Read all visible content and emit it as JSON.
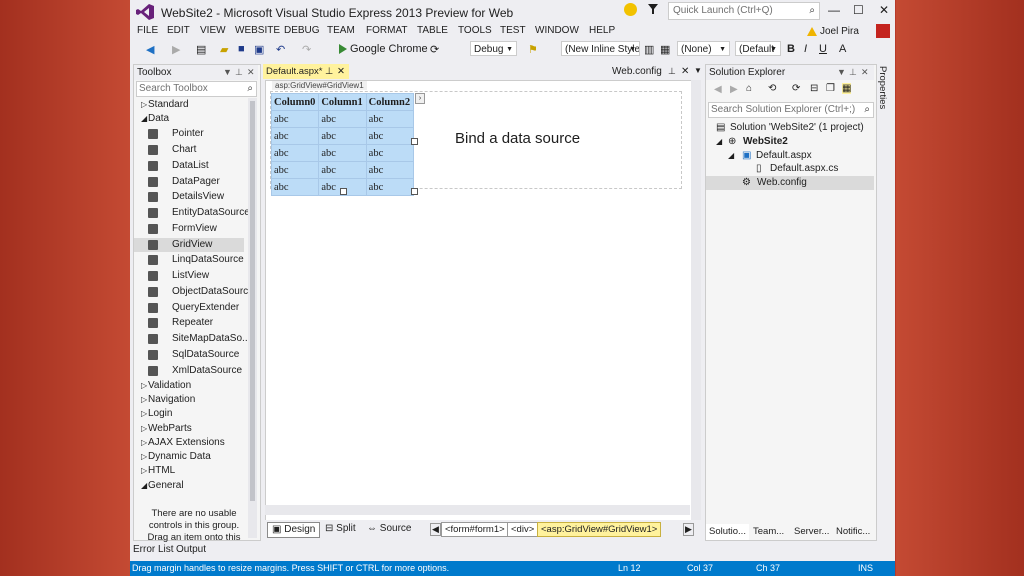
{
  "window": {
    "title": "WebSite2 - Microsoft Visual Studio Express 2013 Preview for Web",
    "quick_launch_placeholder": "Quick Launch (Ctrl+Q)",
    "user_name": "Joel Pira",
    "minimize_glyph": "—",
    "maximize_glyph": "☐",
    "close_glyph": "✕"
  },
  "menu": [
    "FILE",
    "EDIT",
    "VIEW",
    "WEBSITE",
    "DEBUG",
    "TEAM",
    "FORMAT",
    "TABLE",
    "TOOLS",
    "TEST",
    "WINDOW",
    "HELP"
  ],
  "toolbar": {
    "browser": "Google Chrome",
    "config": "Debug",
    "style": "(New Inline Style",
    "target": "(None)",
    "font": "(Default",
    "bold": "B",
    "italic": "I",
    "underline": "U"
  },
  "toolbox": {
    "title": "Toolbox",
    "search_placeholder": "Search Toolbox",
    "categories_top": [
      {
        "label": "Standard",
        "arrow": "▷"
      },
      {
        "label": "Data",
        "arrow": "◢"
      }
    ],
    "data_items": [
      {
        "label": "Pointer",
        "icon": "pointer-icon"
      },
      {
        "label": "Chart",
        "icon": "chart-icon"
      },
      {
        "label": "DataList",
        "icon": "datalist-icon"
      },
      {
        "label": "DataPager",
        "icon": "datapager-icon"
      },
      {
        "label": "DetailsView",
        "icon": "detailsview-icon"
      },
      {
        "label": "EntityDataSource",
        "icon": "entitydatasource-icon"
      },
      {
        "label": "FormView",
        "icon": "formview-icon"
      },
      {
        "label": "GridView",
        "icon": "gridview-icon",
        "selected": true
      },
      {
        "label": "LinqDataSource",
        "icon": "linqdatasource-icon"
      },
      {
        "label": "ListView",
        "icon": "listview-icon"
      },
      {
        "label": "ObjectDataSource",
        "icon": "objectdatasource-icon"
      },
      {
        "label": "QueryExtender",
        "icon": "queryextender-icon"
      },
      {
        "label": "Repeater",
        "icon": "repeater-icon"
      },
      {
        "label": "SiteMapDataSo...",
        "icon": "sitemapdatasource-icon"
      },
      {
        "label": "SqlDataSource",
        "icon": "sqldatasource-icon"
      },
      {
        "label": "XmlDataSource",
        "icon": "xmldatasource-icon"
      }
    ],
    "categories_bottom": [
      {
        "label": "Validation",
        "arrow": "▷"
      },
      {
        "label": "Navigation",
        "arrow": "▷"
      },
      {
        "label": "Login",
        "arrow": "▷"
      },
      {
        "label": "WebParts",
        "arrow": "▷"
      },
      {
        "label": "AJAX Extensions",
        "arrow": "▷"
      },
      {
        "label": "Dynamic Data",
        "arrow": "▷"
      },
      {
        "label": "HTML",
        "arrow": "▷"
      },
      {
        "label": "General",
        "arrow": "◢"
      }
    ],
    "empty_message": "There are no usable controls in this group. Drag an item onto this"
  },
  "editor": {
    "doc_tab": "Default.aspx*",
    "other_tab": "Web.config",
    "control_tag": "asp:GridView#GridView1",
    "grid_headers": [
      "Column0",
      "Column1",
      "Column2"
    ],
    "grid_rows": [
      [
        "abc",
        "abc",
        "abc"
      ],
      [
        "abc",
        "abc",
        "abc"
      ],
      [
        "abc",
        "abc",
        "abc"
      ],
      [
        "abc",
        "abc",
        "abc"
      ],
      [
        "abc",
        "abc",
        "abc"
      ]
    ],
    "annotation": "Bind a data source",
    "views": [
      "Design",
      "Split",
      "Source"
    ],
    "breadcrumbs": [
      "<form#form1>",
      "<div>",
      "<asp:GridView#GridView1>"
    ]
  },
  "solution_explorer": {
    "title": "Solution Explorer",
    "search_placeholder": "Search Solution Explorer (Ctrl+;)",
    "tree": [
      {
        "label": "Solution 'WebSite2' (1 project)",
        "bold": false
      },
      {
        "label": "WebSite2",
        "bold": true
      },
      {
        "label": "Default.aspx",
        "bold": false
      },
      {
        "label": "Default.aspx.cs",
        "bold": false
      },
      {
        "label": "Web.config",
        "bold": false,
        "selected": true
      }
    ],
    "tabs": [
      "Solutio...",
      "Team...",
      "Server...",
      "Notific..."
    ]
  },
  "properties_rail": "Properties",
  "bottom_tabs": [
    "Error List",
    "Output"
  ],
  "status": {
    "message": "Drag margin handles to resize margins. Press SHIFT or CTRL for more options.",
    "line": "Ln 12",
    "col": "Col 37",
    "ch": "Ch 37",
    "mode": "INS"
  },
  "colors": {
    "accent": "#007acc",
    "selection": "#fff29d",
    "grid_fill": "#bcdcf7",
    "background": "#b83a2a"
  }
}
